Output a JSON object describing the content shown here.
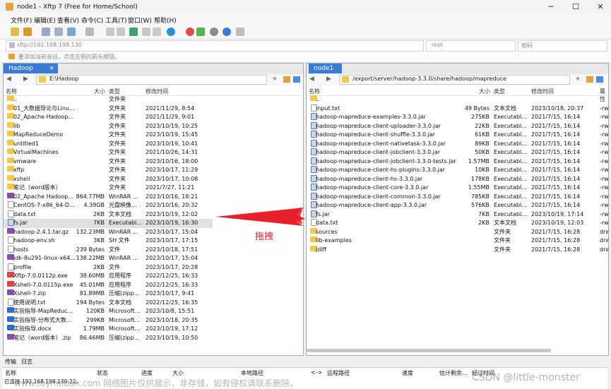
{
  "window": {
    "title": "node1 - Xftp 7 (Free for Home/School)"
  },
  "menu": [
    "文件(F)",
    "编辑(E)",
    "查看(V)",
    "命令(C)",
    "工具(T)",
    "窗口(W)",
    "帮助(H)"
  ],
  "address": {
    "url": "sftp://192.168.198.130",
    "user": "root",
    "password_placeholder": "密码"
  },
  "hint": "要添加当前会话，点击左侧的箭头按钮。",
  "left": {
    "tab": "Hadoop",
    "path": "E:\\Hadoop",
    "columns": [
      "名称",
      "大小",
      "类型",
      "修改时间"
    ],
    "rows": [
      {
        "name": "..",
        "size": "",
        "type": "文件夹",
        "date": "",
        "icon": "folder"
      },
      {
        "name": "01_大数据导论与Linu...",
        "size": "",
        "type": "文件夹",
        "date": "2021/11/29, 8:54",
        "icon": "folder"
      },
      {
        "name": "02_Apache Hadoop...",
        "size": "",
        "type": "文件夹",
        "date": "2021/11/29, 9:01",
        "icon": "folder"
      },
      {
        "name": "lib",
        "size": "",
        "type": "文件夹",
        "date": "2023/10/19, 10:25",
        "icon": "folder"
      },
      {
        "name": "MapReduceDemo",
        "size": "",
        "type": "文件夹",
        "date": "2023/10/19, 15:45",
        "icon": "folder"
      },
      {
        "name": "untitled1",
        "size": "",
        "type": "文件夹",
        "date": "2023/10/19, 10:41",
        "icon": "folder"
      },
      {
        "name": "VirtualMachines",
        "size": "",
        "type": "文件夹",
        "date": "2021/10/26, 14:31",
        "icon": "folder"
      },
      {
        "name": "vmware",
        "size": "",
        "type": "文件夹",
        "date": "2023/10/16, 18:00",
        "icon": "folder"
      },
      {
        "name": "xftp",
        "size": "",
        "type": "文件夹",
        "date": "2023/10/17, 11:29",
        "icon": "folder"
      },
      {
        "name": "xshell",
        "size": "",
        "type": "文件夹",
        "date": "2023/10/17, 10:08",
        "icon": "folder"
      },
      {
        "name": "笔记（word版本）",
        "size": "",
        "type": "文件夹",
        "date": "2021/7/27, 11:21",
        "icon": "folder"
      },
      {
        "name": "02_Apache Hadoop...",
        "size": "864.77MB",
        "type": "WinRAR ...",
        "date": "2023/10/16, 18:21",
        "icon": "arch"
      },
      {
        "name": "CentOS-7-x86_64-D...",
        "size": "4.39GB",
        "type": "光盘映像...",
        "date": "2023/10/16, 20:32",
        "icon": "file"
      },
      {
        "name": "data.txt",
        "size": "2KB",
        "type": "文本文档",
        "date": "2023/10/19, 12:02",
        "icon": "file"
      },
      {
        "name": "fs.jar",
        "size": "7KB",
        "type": "Executabl...",
        "date": "2023/10/19, 16:30",
        "icon": "jar",
        "selected": true
      },
      {
        "name": "hadoop-2.4.1.tar.gz",
        "size": "132.23MB",
        "type": "WinRAR ...",
        "date": "2023/10/17, 15:04",
        "icon": "arch"
      },
      {
        "name": "hadoop-env.sh",
        "size": "3KB",
        "type": "SH 文件",
        "date": "2023/10/17, 17:15",
        "icon": "file"
      },
      {
        "name": "hosts",
        "size": "239 Bytes",
        "type": "文件",
        "date": "2023/10/18, 17:51",
        "icon": "file"
      },
      {
        "name": "jdk-8u291-linux-x64...",
        "size": "138.22MB",
        "type": "WinRAR ...",
        "date": "2023/10/17, 15:04",
        "icon": "arch"
      },
      {
        "name": "profile",
        "size": "2KB",
        "type": "文件",
        "date": "2023/10/17, 20:28",
        "icon": "file"
      },
      {
        "name": "Xftp-7.0.0112p.exe",
        "size": "38.60MB",
        "type": "应用程序",
        "date": "2022/12/25, 16:33",
        "icon": "exe"
      },
      {
        "name": "Xshell-7.0.0115p.exe",
        "size": "45.01MB",
        "type": "应用程序",
        "date": "2022/12/25, 16:33",
        "icon": "exe"
      },
      {
        "name": "Xshell-7.zip",
        "size": "81.89MB",
        "type": "压缩(zipp...",
        "date": "2023/10/17, 9:41",
        "icon": "arch"
      },
      {
        "name": "使用说明.txt",
        "size": "194 Bytes",
        "type": "文本文档",
        "date": "2022/12/25, 16:35",
        "icon": "file"
      },
      {
        "name": "实验指导-MapReduc...",
        "size": "120KB",
        "type": "Microsoft...",
        "date": "2023/10/8, 15:51",
        "icon": "doc"
      },
      {
        "name": "实验指导-分布式大数...",
        "size": "299KB",
        "type": "Microsoft...",
        "date": "2023/10/18, 20:35",
        "icon": "doc"
      },
      {
        "name": "实验指导.docx",
        "size": "1.79MB",
        "type": "Microsoft...",
        "date": "2023/10/19, 17:12",
        "icon": "doc"
      },
      {
        "name": "笔记（word版本）.zip",
        "size": "86.46MB",
        "type": "压缩(zipp...",
        "date": "2023/10/19, 10:50",
        "icon": "arch"
      }
    ]
  },
  "right": {
    "tab": "node1",
    "path": "/export/server/hadoop-3.3.0/share/hadoop/mapreduce",
    "columns": [
      "名称",
      "大小",
      "类型",
      "修改时间",
      "属性"
    ],
    "rows": [
      {
        "name": "..",
        "size": "",
        "type": "",
        "date": "",
        "attr": "",
        "icon": "folder"
      },
      {
        "name": "input.txt",
        "size": "49 Bytes",
        "type": "文本文档",
        "date": "2023/10/18, 20:37",
        "attr": "-rw",
        "icon": "file"
      },
      {
        "name": "hadoop-mapreduce-examples-3.3.0.jar",
        "size": "275KB",
        "type": "Executabl...",
        "date": "2021/7/15, 16:14",
        "attr": "-rw",
        "icon": "jar"
      },
      {
        "name": "hadoop-mapreduce-client-uploader-3.3.0.jar",
        "size": "22KB",
        "type": "Executabl...",
        "date": "2021/7/15, 16:14",
        "attr": "-rw",
        "icon": "jar"
      },
      {
        "name": "hadoop-mapreduce-client-shuffle-3.3.0.jar",
        "size": "61KB",
        "type": "Executabl...",
        "date": "2021/7/15, 16:14",
        "attr": "-rw",
        "icon": "jar"
      },
      {
        "name": "hadoop-mapreduce-client-nativetask-3.3.0.jar",
        "size": "89KB",
        "type": "Executabl...",
        "date": "2021/7/15, 16:14",
        "attr": "-rw",
        "icon": "jar"
      },
      {
        "name": "hadoop-mapreduce-client-jobclient-3.3.0.jar",
        "size": "50KB",
        "type": "Executabl...",
        "date": "2021/7/15, 16:14",
        "attr": "-rw",
        "icon": "jar"
      },
      {
        "name": "hadoop-mapreduce-client-jobclient-3.3.0-tests.jar",
        "size": "1.57MB",
        "type": "Executabl...",
        "date": "2021/7/15, 16:14",
        "attr": "-rw",
        "icon": "jar"
      },
      {
        "name": "hadoop-mapreduce-client-hs-plugins-3.3.0.jar",
        "size": "10KB",
        "type": "Executabl...",
        "date": "2021/7/15, 16:14",
        "attr": "-rw",
        "icon": "jar"
      },
      {
        "name": "hadoop-mapreduce-client-hs-3.3.0.jar",
        "size": "178KB",
        "type": "Executabl...",
        "date": "2021/7/15, 16:14",
        "attr": "-rw",
        "icon": "jar"
      },
      {
        "name": "hadoop-mapreduce-client-core-3.3.0.jar",
        "size": "1.55MB",
        "type": "Executabl...",
        "date": "2021/7/15, 16:14",
        "attr": "-rw",
        "icon": "jar"
      },
      {
        "name": "hadoop-mapreduce-client-common-3.3.0.jar",
        "size": "785KB",
        "type": "Executabl...",
        "date": "2021/7/15, 16:14",
        "attr": "-rw",
        "icon": "jar"
      },
      {
        "name": "hadoop-mapreduce-client-app-3.3.0.jar",
        "size": "576KB",
        "type": "Executabl...",
        "date": "2021/7/15, 16:14",
        "attr": "-rw",
        "icon": "jar"
      },
      {
        "name": "fs.jar",
        "size": "7KB",
        "type": "Executabl...",
        "date": "2023/10/19, 17:14",
        "attr": "-rw",
        "icon": "jar"
      },
      {
        "name": "data.txt",
        "size": "2KB",
        "type": "文本文档",
        "date": "2023/10/19, 12:03",
        "attr": "-rw",
        "icon": "file"
      },
      {
        "name": "sources",
        "size": "",
        "type": "文件夹",
        "date": "2021/7/15, 16:28",
        "attr": "drw",
        "icon": "folder"
      },
      {
        "name": "lib-examples",
        "size": "",
        "type": "文件夹",
        "date": "2021/7/15, 16:28",
        "attr": "drw",
        "icon": "folder"
      },
      {
        "name": "jdiff",
        "size": "",
        "type": "文件夹",
        "date": "2021/7/15, 16:28",
        "attr": "drw",
        "icon": "folder"
      }
    ]
  },
  "annotation": "拖拽",
  "bottom": {
    "tabs": [
      "传输",
      "日志"
    ],
    "columns": [
      "名称",
      "状态",
      "进度",
      "大小",
      "本地路径",
      "<->",
      "远程路径",
      "速度",
      "估计剩余...",
      "经过时间"
    ],
    "status": "已连接 192.168.198.130:22。"
  },
  "watermark": "www.toymoban.com 网络图片仅供展示，非存储，如有侵权请联系删除。",
  "watermark2": "CSDN @little-monster",
  "colors": {
    "accent": "#3a7bd5",
    "arrow": "#e8202a",
    "selected_row": "#e1e1e1"
  }
}
